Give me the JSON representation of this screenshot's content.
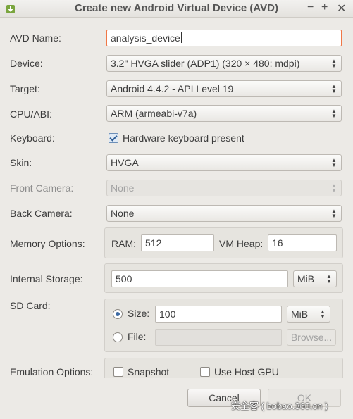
{
  "window": {
    "title": "Create new Android Virtual Device (AVD)",
    "controls": {
      "minimize": "−",
      "maximize": "+",
      "close": "✕"
    }
  },
  "form": {
    "avd_name": {
      "label": "AVD Name:",
      "value": "analysis_device"
    },
    "device": {
      "label": "Device:",
      "value": "3.2\" HVGA slider (ADP1) (320 × 480: mdpi)"
    },
    "target": {
      "label": "Target:",
      "value": "Android 4.4.2 - API Level 19"
    },
    "cpu_abi": {
      "label": "CPU/ABI:",
      "value": "ARM (armeabi-v7a)"
    },
    "keyboard": {
      "label": "Keyboard:",
      "checkbox_label": "Hardware keyboard present",
      "checked": true
    },
    "skin": {
      "label": "Skin:",
      "value": "HVGA"
    },
    "front_camera": {
      "label": "Front Camera:",
      "value": "None",
      "enabled": false
    },
    "back_camera": {
      "label": "Back Camera:",
      "value": "None"
    },
    "memory": {
      "label": "Memory Options:",
      "ram_label": "RAM:",
      "ram_value": "512",
      "heap_label": "VM Heap:",
      "heap_value": "16"
    },
    "internal_storage": {
      "label": "Internal Storage:",
      "value": "500",
      "unit": "MiB"
    },
    "sd_card": {
      "label": "SD Card:",
      "size_label": "Size:",
      "size_value": "100",
      "size_unit": "MiB",
      "file_label": "File:",
      "file_value": "",
      "browse_label": "Browse...",
      "selected": "size"
    },
    "emulation": {
      "label": "Emulation Options:",
      "snapshot_label": "Snapshot",
      "gpu_label": "Use Host GPU",
      "snapshot": false,
      "gpu": false
    }
  },
  "buttons": {
    "cancel": "Cancel",
    "ok": "OK"
  },
  "watermark": "安全客 ( bobao.360.cn )",
  "colors": {
    "focus_border": "#f07746",
    "background": "#eceae6",
    "check_accent": "#3d6aa3"
  }
}
